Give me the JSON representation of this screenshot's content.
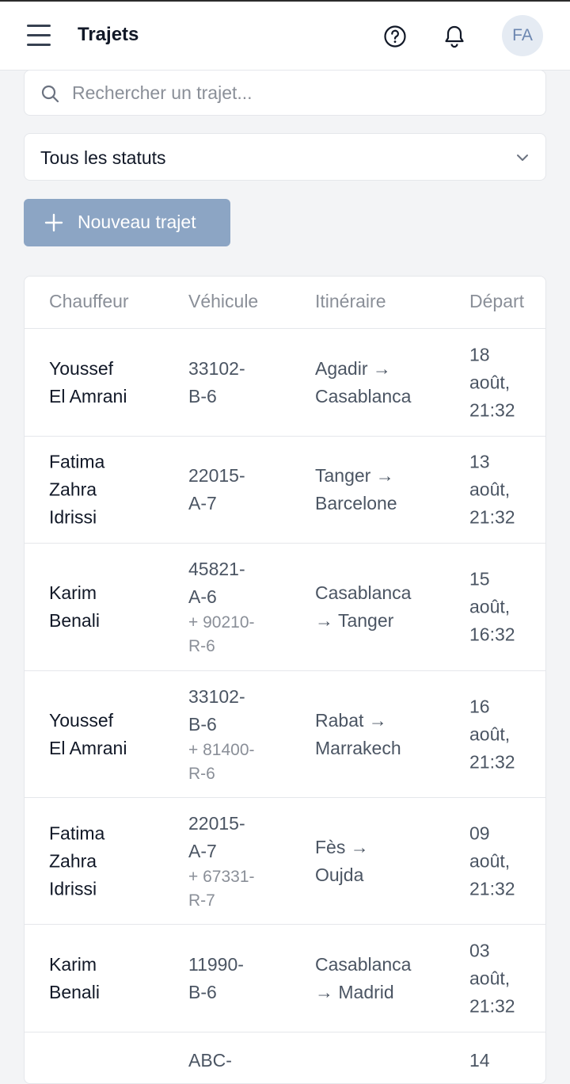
{
  "header": {
    "title": "Trajets",
    "avatar_initials": "FA"
  },
  "search": {
    "placeholder": "Rechercher un trajet..."
  },
  "status_filter": {
    "selected": "Tous les statuts"
  },
  "new_button": {
    "label": "Nouveau trajet"
  },
  "table": {
    "columns": [
      "Chauffeur",
      "Véhicule",
      "Itinéraire",
      "Départ"
    ],
    "rows": [
      {
        "driver": [
          "Youssef",
          "El Amrani"
        ],
        "vehicle": [
          "33102-",
          "B-6"
        ],
        "vehicle_extra": [],
        "route": [
          "Agadir →",
          "Casablanca"
        ],
        "depart": [
          "18",
          "août,",
          "21:32"
        ]
      },
      {
        "driver": [
          "Fatima",
          "Zahra",
          "Idrissi"
        ],
        "vehicle": [
          "22015-",
          "A-7"
        ],
        "vehicle_extra": [],
        "route": [
          "Tanger →",
          "Barcelone"
        ],
        "depart": [
          "13",
          "août,",
          "21:32"
        ]
      },
      {
        "driver": [
          "Karim",
          "Benali"
        ],
        "vehicle": [
          "45821-",
          "A-6"
        ],
        "vehicle_extra": [
          "+ 90210-",
          "R-6"
        ],
        "route": [
          "Casablanca",
          "→ Tanger"
        ],
        "depart": [
          "15",
          "août,",
          "16:32"
        ]
      },
      {
        "driver": [
          "Youssef",
          "El Amrani"
        ],
        "vehicle": [
          "33102-",
          "B-6"
        ],
        "vehicle_extra": [
          "+ 81400-",
          "R-6"
        ],
        "route": [
          "Rabat →",
          "Marrakech"
        ],
        "depart": [
          "16",
          "août,",
          "21:32"
        ]
      },
      {
        "driver": [
          "Fatima",
          "Zahra",
          "Idrissi"
        ],
        "vehicle": [
          "22015-",
          "A-7"
        ],
        "vehicle_extra": [
          "+ 67331-",
          "R-7"
        ],
        "route": [
          "Fès →",
          "Oujda"
        ],
        "depart": [
          "09",
          "août,",
          "21:32"
        ]
      },
      {
        "driver": [
          "Karim",
          "Benali"
        ],
        "vehicle": [
          "11990-",
          "B-6"
        ],
        "vehicle_extra": [],
        "route": [
          "Casablanca",
          "→ Madrid"
        ],
        "depart": [
          "03",
          "août,",
          "21:32"
        ]
      },
      {
        "driver": [],
        "vehicle": [
          "ABC-"
        ],
        "vehicle_extra": [],
        "route": [],
        "depart": [
          "14"
        ]
      }
    ]
  },
  "colors": {
    "primary_button": "#8ca5c4",
    "avatar_bg": "#e5ebf3",
    "avatar_text": "#6b86b0",
    "border": "#e5e7eb",
    "page_bg": "#f3f4f6"
  },
  "icons": [
    "menu-icon",
    "help-icon",
    "bell-icon",
    "search-icon",
    "chevron-down-icon",
    "plus-icon"
  ]
}
